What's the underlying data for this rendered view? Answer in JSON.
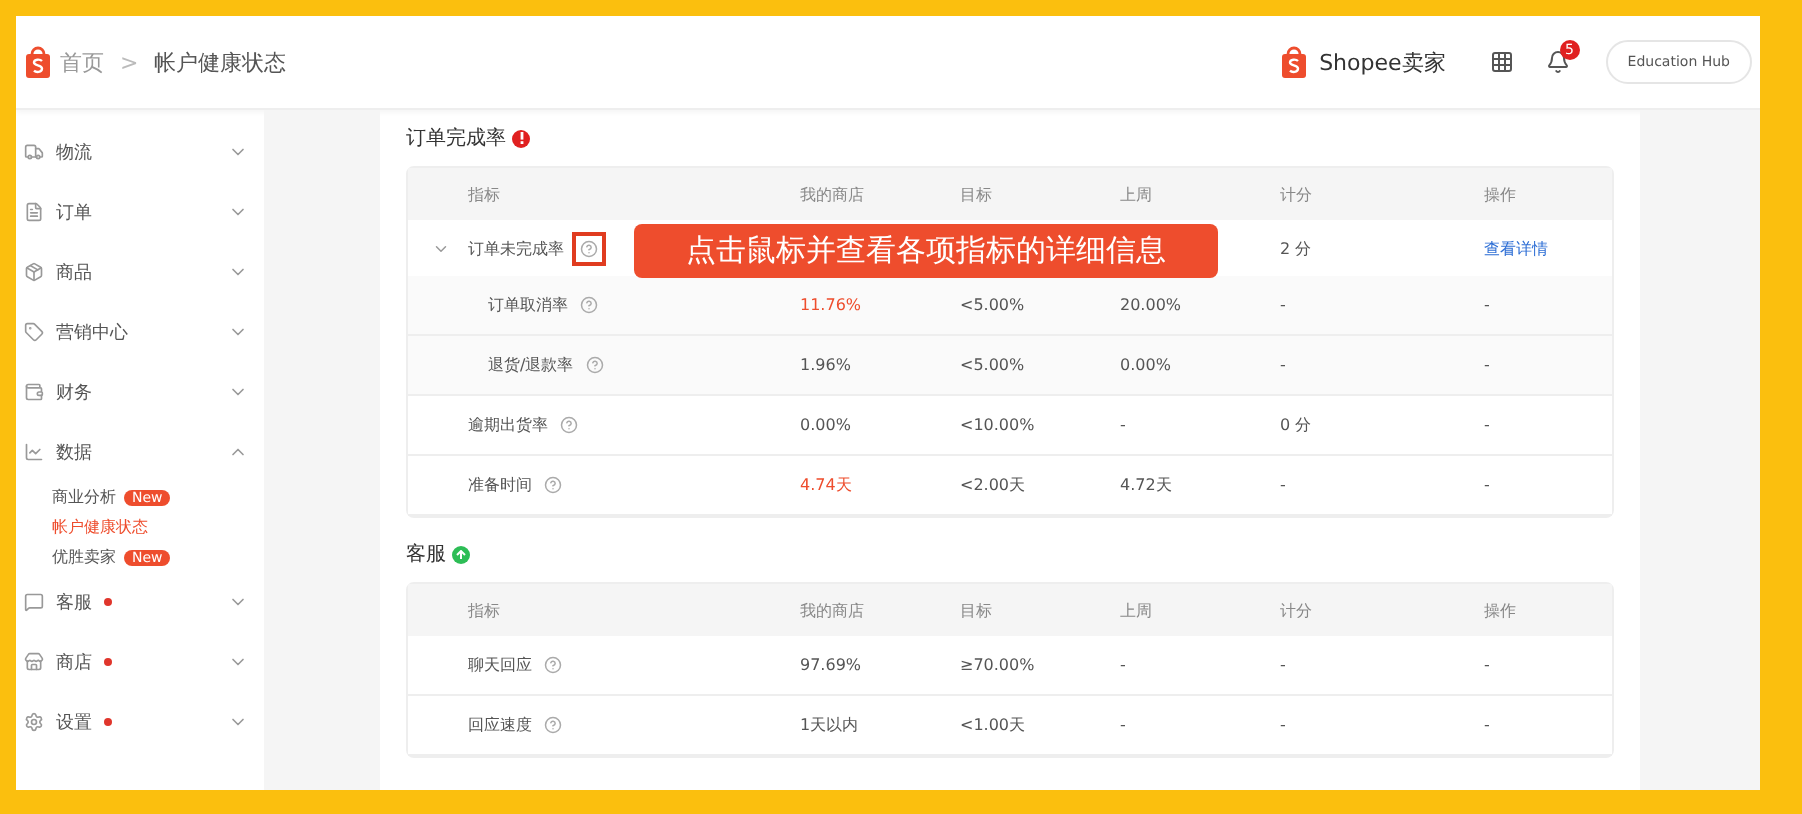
{
  "header": {
    "breadcrumb": [
      {
        "label": "首页"
      },
      {
        "label": "帐户健康状态"
      }
    ],
    "separator": ">",
    "brand": "Shopee卖家",
    "notification_count": "5",
    "education_button": "Education Hub"
  },
  "sidebar": {
    "items": [
      {
        "label": "物流",
        "expanded": false,
        "dot": false
      },
      {
        "label": "订单",
        "expanded": false,
        "dot": false
      },
      {
        "label": "商品",
        "expanded": false,
        "dot": false
      },
      {
        "label": "营销中心",
        "expanded": false,
        "dot": false
      },
      {
        "label": "财务",
        "expanded": false,
        "dot": false
      },
      {
        "label": "数据",
        "expanded": true,
        "dot": false,
        "children": [
          {
            "label": "商业分析",
            "badge": "New",
            "selected": false
          },
          {
            "label": "帐户健康状态",
            "selected": true
          },
          {
            "label": "优胜卖家",
            "badge": "New",
            "selected": false
          }
        ]
      },
      {
        "label": "客服",
        "expanded": false,
        "dot": true
      },
      {
        "label": "商店",
        "expanded": false,
        "dot": true
      },
      {
        "label": "设置",
        "expanded": false,
        "dot": true
      }
    ]
  },
  "sections": [
    {
      "title": "订单完成率",
      "kind": "warning",
      "columns": [
        "指标",
        "我的商店",
        "目标",
        "上周",
        "计分",
        "操作"
      ],
      "rows": [
        {
          "name": "订单未完成率",
          "expanded": true,
          "highlighted": true,
          "score": "2 分",
          "action": "查看详情",
          "callout": "点击鼠标并查看各项指标的详细信息",
          "children": [
            {
              "name": "订单取消率",
              "mine": "11.76%",
              "bad": true,
              "target": "<5.00%",
              "last_week": "20.00%",
              "score": "-",
              "action": "-"
            },
            {
              "name": "退货/退款率",
              "mine": "1.96%",
              "bad": false,
              "target": "<5.00%",
              "last_week": "0.00%",
              "score": "-",
              "action": "-"
            }
          ]
        },
        {
          "name": "逾期出货率",
          "mine": "0.00%",
          "bad": false,
          "target": "<10.00%",
          "last_week": "-",
          "score": "0 分",
          "action": "-"
        },
        {
          "name": "准备时间",
          "mine": "4.74天",
          "bad": true,
          "target": "<2.00天",
          "last_week": "4.72天",
          "score": "-",
          "action": "-"
        }
      ]
    },
    {
      "title": "客服",
      "kind": "ok",
      "columns": [
        "指标",
        "我的商店",
        "目标",
        "上周",
        "计分",
        "操作"
      ],
      "rows": [
        {
          "name": "聊天回应",
          "mine": "97.69%",
          "bad": false,
          "target": "≥70.00%",
          "last_week": "-",
          "score": "-",
          "action": "-"
        },
        {
          "name": "回应速度",
          "mine": "1天以内",
          "bad": false,
          "target": "<1.00天",
          "last_week": "-",
          "score": "-",
          "action": "-"
        }
      ]
    }
  ]
}
